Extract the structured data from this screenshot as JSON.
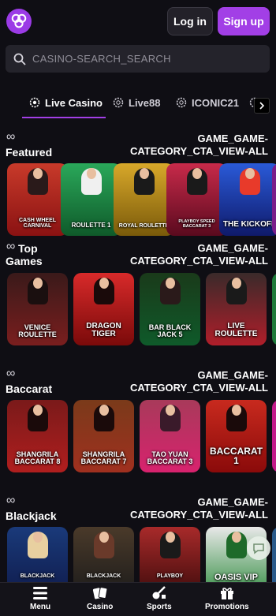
{
  "header": {
    "login_label": "Log in",
    "signup_label": "Sign up",
    "accent_color": "#a23fe6"
  },
  "search": {
    "placeholder": "CASINO-SEARCH_SEARCH"
  },
  "tabs": [
    {
      "label": "Live Casino",
      "icon": "chip-icon",
      "active": true
    },
    {
      "label": "Live88",
      "icon": "chip-icon",
      "active": false
    },
    {
      "label": "ICONIC21",
      "icon": "chip-icon",
      "active": false
    },
    {
      "label": "",
      "icon": "chip-icon",
      "active": false
    }
  ],
  "sections": [
    {
      "title": "Featured",
      "cta": "GAME_GAME-CATEGORY_CTA_VIEW-ALL",
      "games": [
        {
          "name": "CASH WHEEL CARNIVAL",
          "sub": "",
          "bg": "#b42121"
        },
        {
          "name": "ROULETTE 1",
          "sub": "",
          "bg": "#1b8a3d"
        },
        {
          "name": "ROYAL ROULETTE",
          "sub": "",
          "bg": "#b8860b"
        },
        {
          "name": "PLAYBOY SPEED BACCARAT 3",
          "sub": "",
          "bg": "#8f1f3d"
        },
        {
          "name": "THE KICKOFF",
          "sub": "",
          "bg": "#1f3fa8"
        },
        {
          "name": "",
          "sub": "",
          "bg": "#7a1d8a"
        }
      ]
    },
    {
      "title": "Top Games",
      "cta": "GAME_GAME-CATEGORY_CTA_VIEW-ALL",
      "games": [
        {
          "name": "VENICE ROULETTE",
          "sub": "",
          "bg": "#7a2a1e"
        },
        {
          "name": "DRAGON TIGER",
          "sub": "",
          "bg": "#a81f1f"
        },
        {
          "name": "BAR BLACK JACK 5",
          "sub": "",
          "bg": "#1e5c2a"
        },
        {
          "name": "LIVE ROULETTE",
          "sub": "",
          "bg": "#b01e2a"
        },
        {
          "name": "",
          "sub": "",
          "bg": "#1e7a3a"
        }
      ]
    },
    {
      "title": "Baccarat",
      "cta": "GAME_GAME-CATEGORY_CTA_VIEW-ALL",
      "games": [
        {
          "name": "SHANGRILA BACCARAT 8",
          "sub": "",
          "bg": "#9c1f1f"
        },
        {
          "name": "SHANGRILA BACCARAT 7",
          "sub": "",
          "bg": "#a0301f"
        },
        {
          "name": "TAO YUAN BACCARAT 3",
          "sub": "",
          "bg": "#b8226e"
        },
        {
          "name": "BACCARAT 1",
          "sub": "",
          "bg": "#b01e1e"
        },
        {
          "name": "",
          "sub": "",
          "bg": "#c21a8a"
        }
      ]
    },
    {
      "title": "Blackjack",
      "cta": "GAME_GAME-CATEGORY_CTA_VIEW-ALL",
      "games": [
        {
          "name": "BLACKJACK",
          "sub": "",
          "bg": "#1f3f8a"
        },
        {
          "name": "BLACKJACK",
          "sub": "",
          "bg": "#3a2a1e"
        },
        {
          "name": "PLAYBOY",
          "sub": "",
          "bg": "#8a1f2a"
        },
        {
          "name": "OASIS VIP",
          "sub": "",
          "bg": "#1e7a2a"
        },
        {
          "name": "",
          "sub": "",
          "bg": "#2a5a8a"
        }
      ]
    }
  ],
  "bottom_nav": [
    {
      "label": "Menu",
      "icon": "menu-icon"
    },
    {
      "label": "Casino",
      "icon": "cards-icon"
    },
    {
      "label": "Sports",
      "icon": "sports-icon"
    },
    {
      "label": "Promotions",
      "icon": "gift-icon"
    }
  ]
}
